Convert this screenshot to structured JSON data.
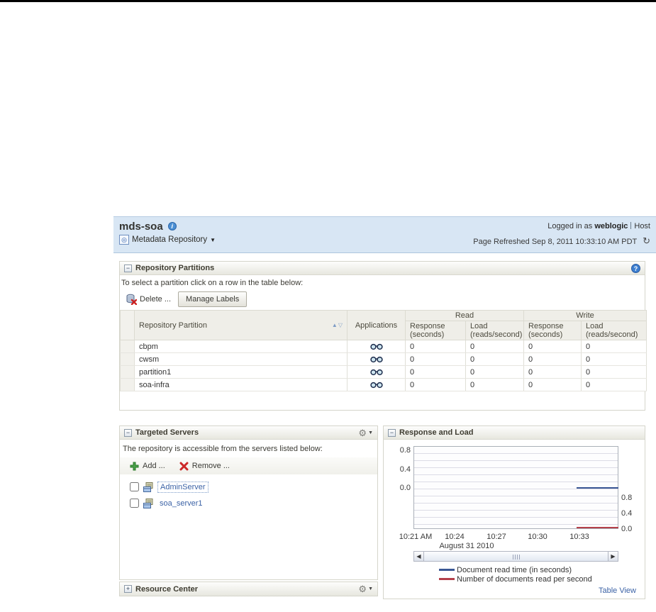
{
  "header": {
    "title": "mds-soa",
    "menu_label": "Metadata Repository",
    "logged_in_as_label": "Logged in as",
    "logged_in_user": "weblogic",
    "host_label": "Host",
    "page_refreshed": "Page Refreshed Sep 8, 2011 10:33:10 AM PDT"
  },
  "partitions_panel": {
    "title": "Repository Partitions",
    "instruction": "To select a partition click on a row in the table below:",
    "toolbar": {
      "delete_label": "Delete ...",
      "manage_labels_label": "Manage Labels"
    },
    "table": {
      "col_partition": "Repository Partition",
      "col_applications": "Applications",
      "group_read": "Read",
      "group_write": "Write",
      "col_response": "Response (seconds)",
      "col_load": "Load (reads/second)",
      "rows": [
        {
          "name": "cbpm",
          "read_response": "0",
          "read_load": "0",
          "write_response": "0",
          "write_load": "0"
        },
        {
          "name": "cwsm",
          "read_response": "0",
          "read_load": "0",
          "write_response": "0",
          "write_load": "0"
        },
        {
          "name": "partition1",
          "read_response": "0",
          "read_load": "0",
          "write_response": "0",
          "write_load": "0"
        },
        {
          "name": "soa-infra",
          "read_response": "0",
          "read_load": "0",
          "write_response": "0",
          "write_load": "0"
        }
      ]
    }
  },
  "targeted_servers_panel": {
    "title": "Targeted Servers",
    "instruction": "The repository is accessible from the servers listed below:",
    "add_label": "Add ...",
    "remove_label": "Remove ...",
    "servers": [
      {
        "name": "AdminServer"
      },
      {
        "name": "soa_server1"
      }
    ]
  },
  "resource_center_panel": {
    "title": "Resource Center"
  },
  "chart_panel": {
    "title": "Response and Load",
    "table_view_label": "Table View",
    "left_axis": [
      "0.8",
      "0.4",
      "0.0"
    ],
    "right_axis": [
      "0.8",
      "0.4",
      "0.0"
    ],
    "x_ticks": [
      "10:21 AM",
      "10:24",
      "10:27",
      "10:30",
      "10:33"
    ],
    "x_date": "August 31 2010",
    "legend": [
      {
        "label": "Document read time (in seconds)",
        "color": "#3a5794"
      },
      {
        "label": "Number of documents read per second",
        "color": "#b4404a"
      }
    ]
  },
  "chart_data": {
    "type": "line",
    "title": "Response and Load",
    "xlabel": "August 31 2010",
    "x_ticks": [
      "10:21 AM",
      "10:24",
      "10:27",
      "10:30",
      "10:33"
    ],
    "y_axis_left": {
      "label": "Document read time (in seconds)",
      "ticks": [
        0.0,
        0.4,
        0.8
      ]
    },
    "y_axis_right": {
      "label": "Number of documents read per second",
      "ticks": [
        0.0,
        0.4,
        0.8
      ]
    },
    "series": [
      {
        "name": "Document read time (in seconds)",
        "color": "#3a5794",
        "axis": "left",
        "x": [
          "10:32",
          "10:35"
        ],
        "values": [
          0.0,
          0.0
        ]
      },
      {
        "name": "Number of documents read per second",
        "color": "#b4404a",
        "axis": "right",
        "x": [
          "10:32",
          "10:35"
        ],
        "values": [
          0.0,
          0.0
        ]
      }
    ],
    "legend_position": "bottom",
    "grid": true
  }
}
